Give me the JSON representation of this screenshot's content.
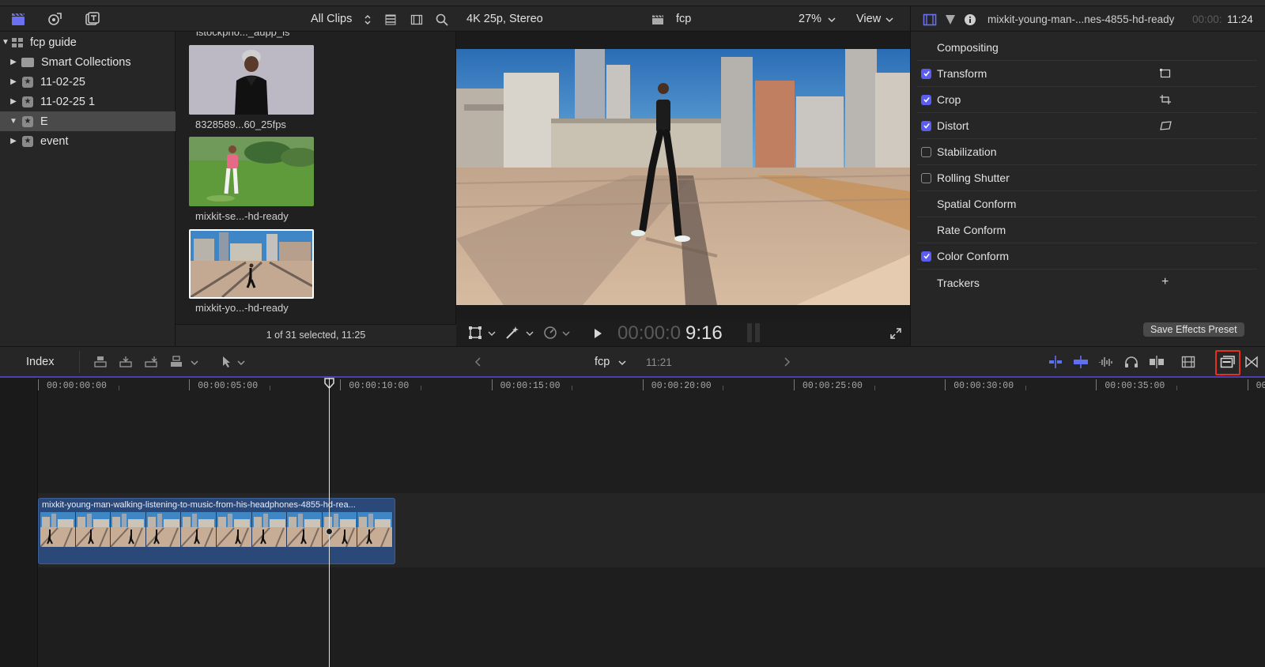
{
  "library": {
    "items": [
      {
        "label": "fcp guide",
        "icon": "library-icon",
        "expanded": true
      },
      {
        "label": "Smart Collections",
        "icon": "folder-icon",
        "expanded": false
      },
      {
        "label": "11-02-25",
        "icon": "event-star-icon",
        "expanded": false
      },
      {
        "label": "11-02-25 1",
        "icon": "event-star-icon",
        "expanded": false
      },
      {
        "label": "E",
        "icon": "event-star-icon",
        "expanded": true,
        "selected": true
      },
      {
        "label": "event",
        "icon": "event-star-icon",
        "expanded": false
      }
    ]
  },
  "browser": {
    "filter": "All Clips",
    "clips": [
      {
        "label": "istockpho..._aupp_is"
      },
      {
        "label": "8328589...60_25fps"
      },
      {
        "label": "mixkit-se...-hd-ready"
      },
      {
        "label": "mixkit-yo...-hd-ready",
        "selected": true
      }
    ],
    "status": "1 of 31 selected, 11:25"
  },
  "viewer": {
    "format": "4K 25p, Stereo",
    "project": "fcp",
    "zoom": "27%",
    "view_label": "View",
    "timecode_dim": "00:00:0",
    "timecode_bright": "9:16"
  },
  "inspector": {
    "clip_name": "mixkit-young-man-...nes-4855-hd-ready",
    "duration_dim": "00:00:",
    "duration_bright": "11:24",
    "rows": [
      {
        "label": "Compositing",
        "checkbox": null
      },
      {
        "label": "Transform",
        "checkbox": true
      },
      {
        "label": "Crop",
        "checkbox": true
      },
      {
        "label": "Distort",
        "checkbox": true
      },
      {
        "label": "Stabilization",
        "checkbox": false
      },
      {
        "label": "Rolling Shutter",
        "checkbox": false
      },
      {
        "label": "Spatial Conform",
        "checkbox": null
      },
      {
        "label": "Rate Conform",
        "checkbox": null
      },
      {
        "label": "Color Conform",
        "checkbox": true
      },
      {
        "label": "Trackers",
        "checkbox": null
      }
    ],
    "trackers_add": "+",
    "save_preset": "Save Effects Preset"
  },
  "timeline": {
    "index_label": "Index",
    "project": "fcp",
    "duration": "11:21",
    "ruler": [
      "00:00:00:00",
      "00:00:05:00",
      "00:00:10:00",
      "00:00:15:00",
      "00:00:20:00",
      "00:00:25:00",
      "00:00:30:00",
      "00:00:35:00",
      "00"
    ],
    "clip_title": "mixkit-young-man-walking-listening-to-music-from-his-headphones-4855-hd-rea..."
  },
  "colors": {
    "accent": "#5a5df0",
    "clip_blue": "#2a4878",
    "highlight": "#e0321e"
  }
}
